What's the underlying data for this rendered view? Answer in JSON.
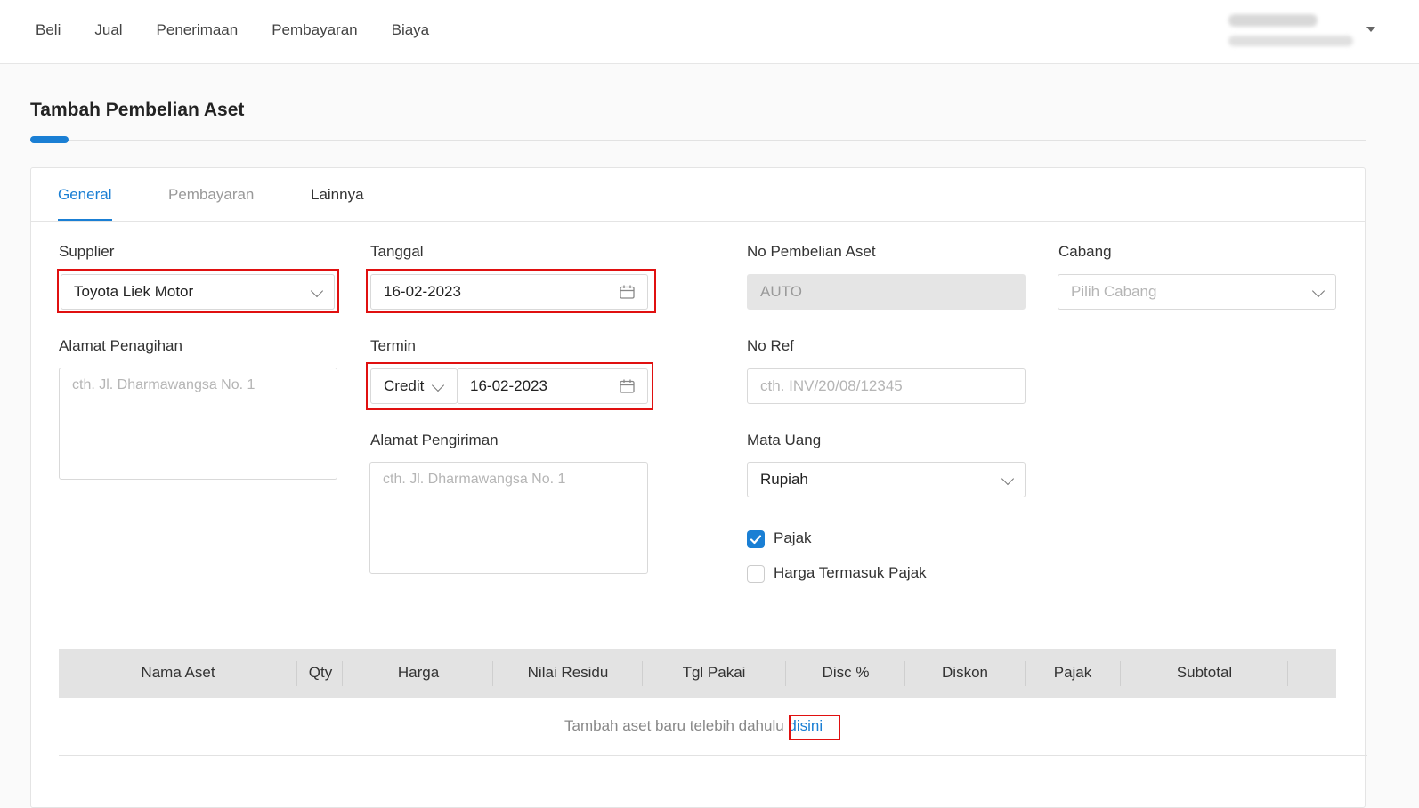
{
  "nav": {
    "items": [
      "Beli",
      "Jual",
      "Penerimaan",
      "Pembayaran",
      "Biaya"
    ]
  },
  "page": {
    "title": "Tambah Pembelian Aset"
  },
  "tabs": [
    "General",
    "Pembayaran",
    "Lainnya"
  ],
  "form": {
    "supplier": {
      "label": "Supplier",
      "value": "Toyota Liek Motor"
    },
    "tanggal": {
      "label": "Tanggal",
      "value": "16-02-2023"
    },
    "no_pembelian": {
      "label": "No Pembelian Aset",
      "value": "AUTO"
    },
    "cabang": {
      "label": "Cabang",
      "placeholder": "Pilih Cabang"
    },
    "alamat_penagihan": {
      "label": "Alamat Penagihan",
      "placeholder": "cth. Jl. Dharmawangsa No. 1"
    },
    "termin": {
      "label": "Termin",
      "type": "Credit",
      "date": "16-02-2023"
    },
    "no_ref": {
      "label": "No Ref",
      "placeholder": "cth. INV/20/08/12345"
    },
    "alamat_pengiriman": {
      "label": "Alamat Pengiriman",
      "placeholder": "cth. Jl. Dharmawangsa No. 1"
    },
    "mata_uang": {
      "label": "Mata Uang",
      "value": "Rupiah"
    },
    "pajak": {
      "label": "Pajak",
      "checked": true
    },
    "harga_termasuk_pajak": {
      "label": "Harga Termasuk Pajak",
      "checked": false
    }
  },
  "table": {
    "headers": [
      "Nama Aset",
      "Qty",
      "Harga",
      "Nilai Residu",
      "Tgl Pakai",
      "Disc %",
      "Diskon",
      "Pajak",
      "Subtotal"
    ],
    "empty_text": "Tambah aset baru telebih dahulu",
    "empty_link": "disini"
  },
  "colors": {
    "accent": "#1a7fd4",
    "highlight": "#e01010"
  }
}
